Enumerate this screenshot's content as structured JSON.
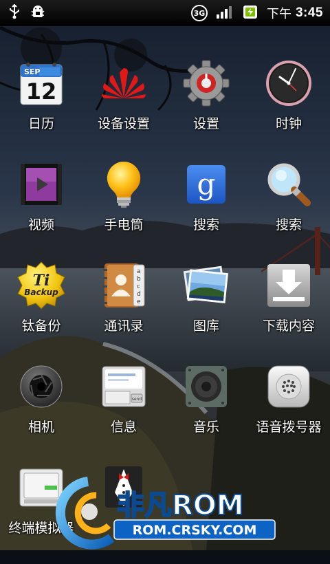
{
  "status_bar": {
    "network": "3G",
    "ampm": "下午",
    "time": "3:45"
  },
  "apps": [
    {
      "label": "日历",
      "icon": "calendar-icon",
      "month": "SEP",
      "day": "12"
    },
    {
      "label": "设备设置",
      "icon": "huawei-logo-icon"
    },
    {
      "label": "设置",
      "icon": "gear-icon"
    },
    {
      "label": "时钟",
      "icon": "clock-icon"
    },
    {
      "label": "视频",
      "icon": "video-icon"
    },
    {
      "label": "手电筒",
      "icon": "lightbulb-icon"
    },
    {
      "label": "搜索",
      "icon": "google-search-icon",
      "glyph": "g"
    },
    {
      "label": "搜索",
      "icon": "magnifier-icon"
    },
    {
      "label": "钛备份",
      "icon": "titanium-backup-icon",
      "line1": "Ti",
      "line2": "Backup"
    },
    {
      "label": "通讯录",
      "icon": "contacts-book-icon",
      "tabs": [
        "a",
        "b",
        "c",
        "d",
        "e"
      ]
    },
    {
      "label": "图库",
      "icon": "gallery-icon"
    },
    {
      "label": "下载内容",
      "icon": "download-icon"
    },
    {
      "label": "相机",
      "icon": "camera-icon"
    },
    {
      "label": "信息",
      "icon": "messaging-icon",
      "send": "send"
    },
    {
      "label": "音乐",
      "icon": "music-speaker-icon"
    },
    {
      "label": "语音拨号器",
      "icon": "voice-dialer-icon"
    },
    {
      "label": "终端模拟器",
      "icon": "terminal-icon"
    },
    {
      "label": "",
      "icon": "tuxedo-icon"
    }
  ],
  "watermark": {
    "brand": "非凡ROM",
    "url": "ROM.CRSKY.COM"
  },
  "colors": {
    "status_bar": "#000000",
    "watermark_green": "#7cd321",
    "watermark_blue": "#1f7fd6"
  }
}
